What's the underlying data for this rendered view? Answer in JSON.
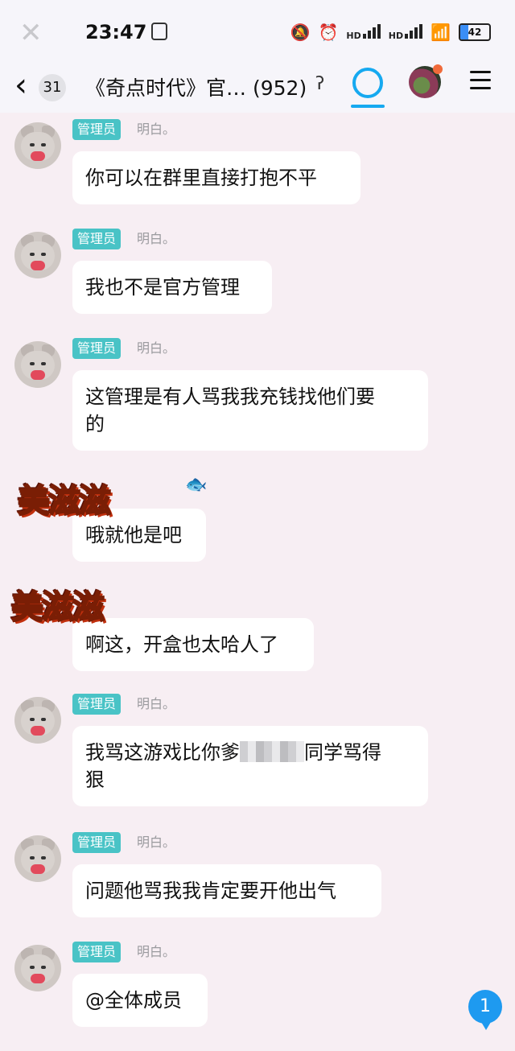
{
  "status_bar": {
    "time": "23:47",
    "signal_labels": [
      "HD",
      "HD"
    ],
    "battery": "42"
  },
  "header": {
    "back_count": "31",
    "title": "《奇点时代》官…",
    "member_count": "(952)"
  },
  "messages": [
    {
      "role": "管理员",
      "nick": "明白。",
      "text": "你可以在群里直接打抱不平"
    },
    {
      "role": "管理员",
      "nick": "明白。",
      "text": "我也不是官方管理"
    },
    {
      "role": "管理员",
      "nick": "明白。",
      "text_lines": [
        "这管理是有人骂我我充钱找他们要",
        "的"
      ]
    },
    {
      "text": "哦就他是吧"
    },
    {
      "text": "啊这，开盒也太哈人了"
    },
    {
      "role": "管理员",
      "nick": "明白。",
      "text_parts": [
        "我骂这游戏比你爹",
        "同学骂得"
      ],
      "text_line2": "狠"
    },
    {
      "role": "管理员",
      "nick": "明白。",
      "text": "问题他骂我我肯定要开他出气"
    },
    {
      "role": "管理员",
      "nick": "明白。",
      "text": "@全体成员"
    }
  ],
  "stickers": [
    "美滋滋",
    "美滋滋"
  ],
  "unread_badge": "1",
  "colors": {
    "accent": "#16a9f0",
    "role_badge": "#49c3c6",
    "background": "#f7eef3"
  }
}
